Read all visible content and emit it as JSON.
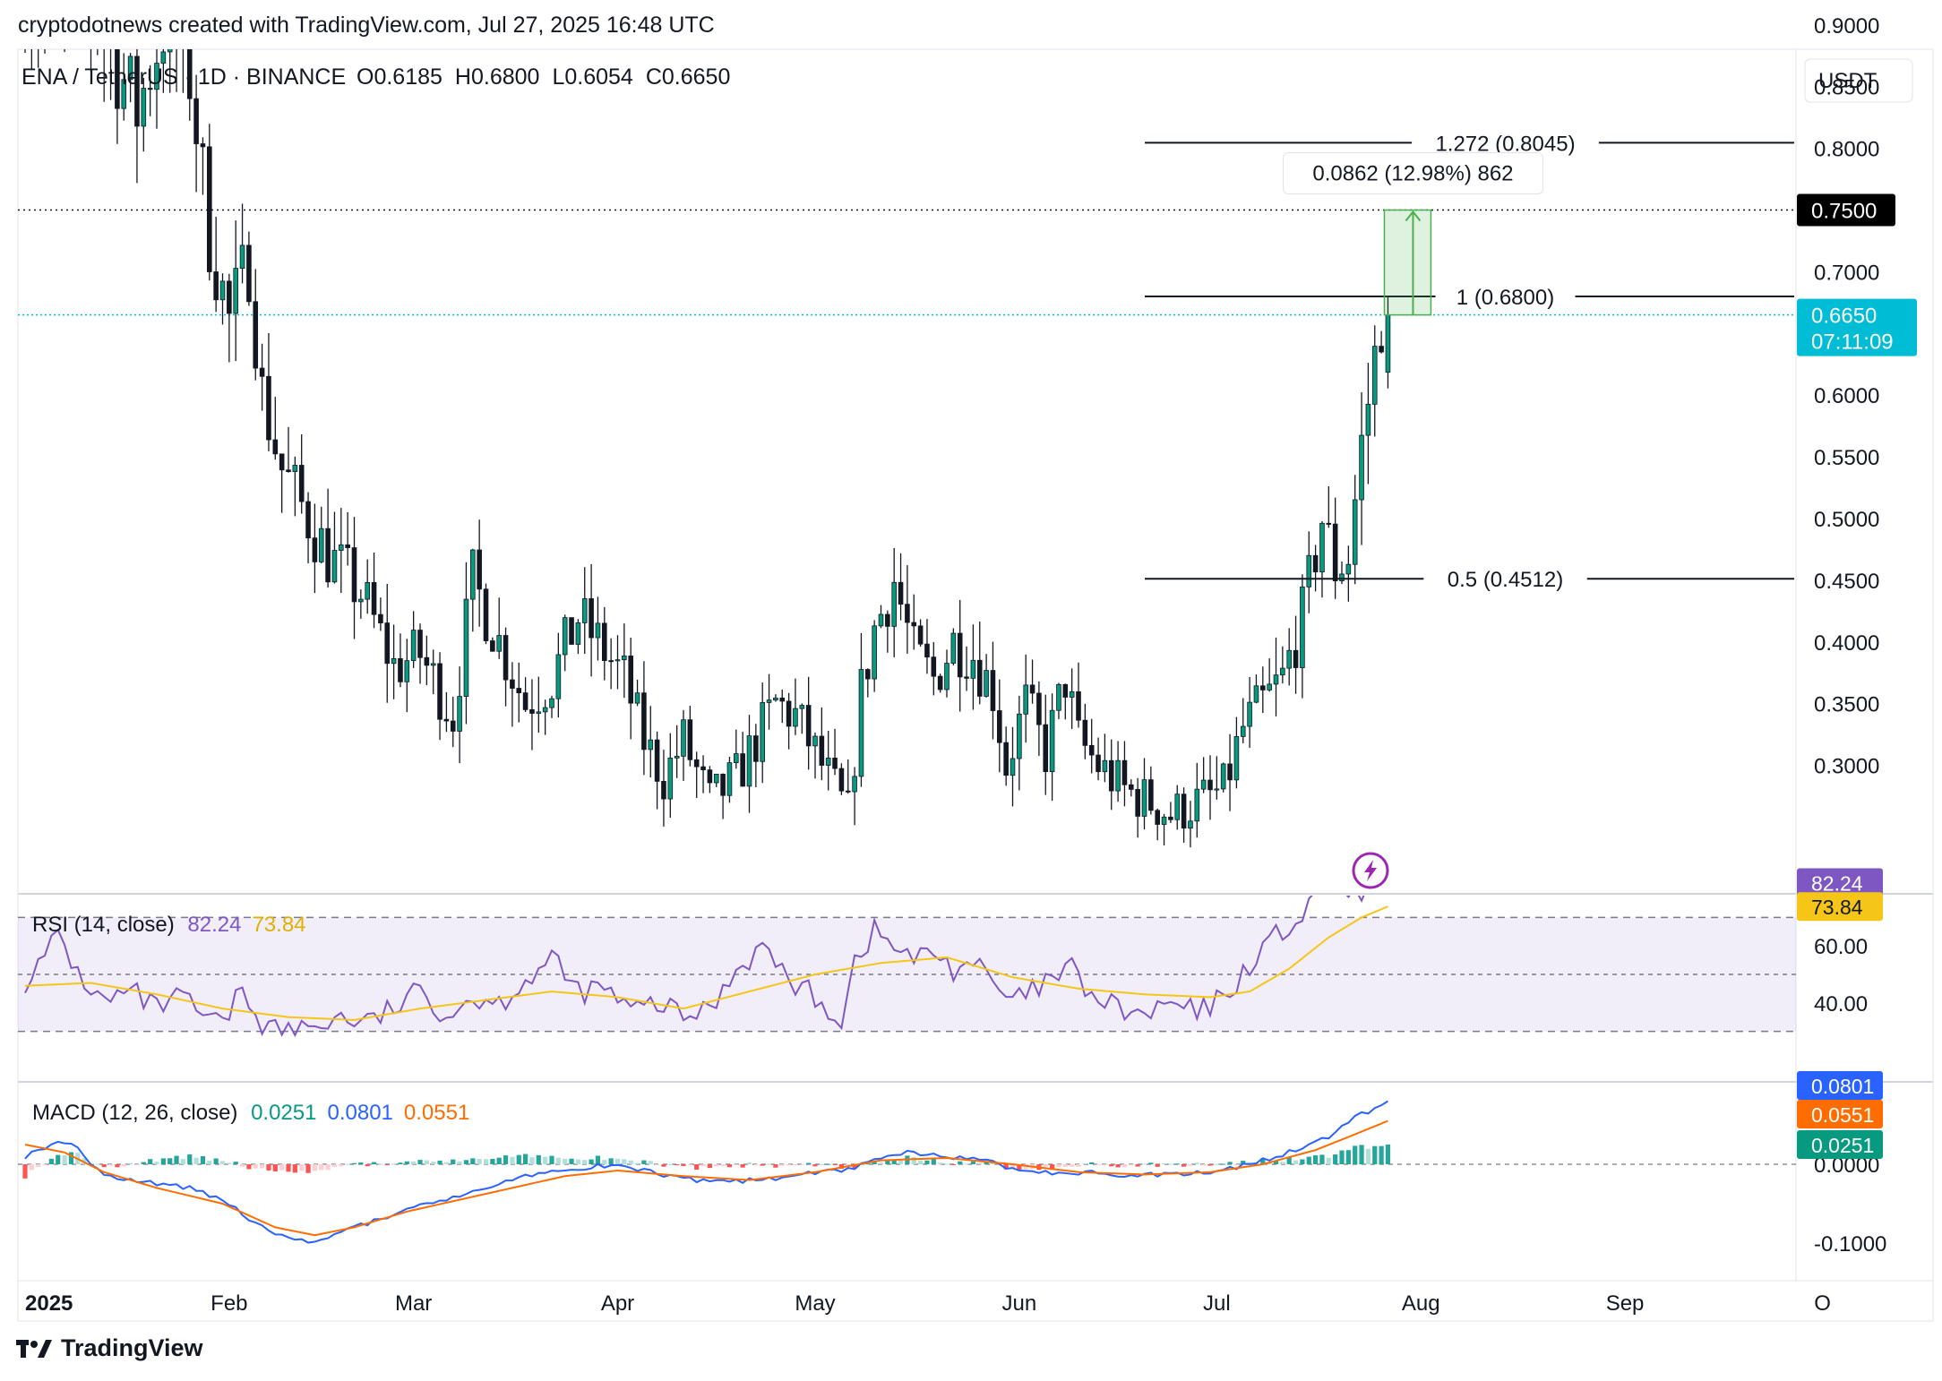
{
  "attribution": "cryptodotnews created with TradingView.com, Jul 27, 2025 16:48 UTC",
  "brand": "TradingView",
  "colors": {
    "up": "#089981",
    "down": "#f23645",
    "rsi": "#7e57c2",
    "rsi_ma": "#f5c518",
    "macd": "#2962ff",
    "signal": "#ff6d00",
    "price_tag": "#00bcd4",
    "level_tag": "#000000"
  },
  "chart_data": [
    {
      "type": "candlestick",
      "symbol_title": "ENA / TetherUS · 1D · BINANCE",
      "ohlc": {
        "o": "0.6185",
        "h": "0.6800",
        "l": "0.6054",
        "c": "0.6650"
      },
      "ohlc_labels": {
        "o": "O",
        "h": "H",
        "l": "L",
        "c": "C"
      },
      "currency": "USDT",
      "ylim": [
        0.27,
        0.96
      ],
      "yticks": [
        "0.9000",
        "0.8500",
        "0.8000",
        "0.7000",
        "0.6000",
        "0.5500",
        "0.5000",
        "0.4500",
        "0.4000",
        "0.3500",
        "0.3000"
      ],
      "x_labels": [
        "2025",
        "Feb",
        "Mar",
        "Apr",
        "May",
        "Jun",
        "Jul",
        "Aug",
        "Sep",
        "O"
      ],
      "x_label_days": [
        0,
        31,
        59,
        90,
        120,
        151,
        181,
        212,
        243,
        273
      ],
      "current_price": "0.6650",
      "countdown": "07:11:09",
      "target_level": "0.7500",
      "fib_levels": [
        {
          "label": "1.272 (0.8045)",
          "value": 0.8045
        },
        {
          "label": "1 (0.6800)",
          "value": 0.68
        },
        {
          "label": "0.5 (0.4512)",
          "value": 0.4512
        }
      ],
      "measure": {
        "label": "0.0862 (12.98%) 862",
        "from": 0.665,
        "to": 0.75
      },
      "anchors": [
        [
          0,
          0.94
        ],
        [
          6,
          0.91
        ],
        [
          10,
          0.93
        ],
        [
          14,
          0.88
        ],
        [
          18,
          0.83
        ],
        [
          22,
          0.9
        ],
        [
          26,
          0.86
        ],
        [
          29,
          0.73
        ],
        [
          32,
          0.66
        ],
        [
          35,
          0.71
        ],
        [
          37,
          0.6
        ],
        [
          40,
          0.54
        ],
        [
          43,
          0.51
        ],
        [
          47,
          0.47
        ],
        [
          52,
          0.44
        ],
        [
          57,
          0.38
        ],
        [
          61,
          0.39
        ],
        [
          66,
          0.34
        ],
        [
          69,
          0.45
        ],
        [
          73,
          0.4
        ],
        [
          77,
          0.35
        ],
        [
          81,
          0.37
        ],
        [
          85,
          0.42
        ],
        [
          88,
          0.4
        ],
        [
          92,
          0.37
        ],
        [
          95,
          0.32
        ],
        [
          98,
          0.29
        ],
        [
          101,
          0.32
        ],
        [
          105,
          0.27
        ],
        [
          109,
          0.29
        ],
        [
          112,
          0.32
        ],
        [
          115,
          0.35
        ],
        [
          118,
          0.34
        ],
        [
          121,
          0.31
        ],
        [
          124,
          0.28
        ],
        [
          126,
          0.26
        ],
        [
          128,
          0.36
        ],
        [
          130,
          0.41
        ],
        [
          133,
          0.45
        ],
        [
          136,
          0.39
        ],
        [
          139,
          0.37
        ],
        [
          142,
          0.4
        ],
        [
          145,
          0.39
        ],
        [
          148,
          0.36
        ],
        [
          150,
          0.3
        ],
        [
          153,
          0.35
        ],
        [
          156,
          0.31
        ],
        [
          159,
          0.37
        ],
        [
          161,
          0.32
        ],
        [
          164,
          0.3
        ],
        [
          168,
          0.28
        ],
        [
          172,
          0.27
        ],
        [
          175,
          0.26
        ],
        [
          179,
          0.27
        ],
        [
          183,
          0.28
        ],
        [
          186,
          0.33
        ],
        [
          189,
          0.35
        ],
        [
          192,
          0.37
        ],
        [
          195,
          0.42
        ],
        [
          198,
          0.5
        ],
        [
          200,
          0.46
        ],
        [
          202,
          0.47
        ],
        [
          204,
          0.56
        ],
        [
          206,
          0.63
        ],
        [
          207,
          0.665
        ]
      ],
      "last_candle": {
        "o": 0.6185,
        "h": 0.68,
        "l": 0.6054,
        "c": 0.665
      }
    },
    {
      "type": "line",
      "title": "RSI (14, close)",
      "values_display": [
        "82.24",
        "73.84"
      ],
      "series_names": [
        "RSI",
        "RSI-based MA"
      ],
      "ylim": [
        22,
        89
      ],
      "yticks": [
        "60.00",
        "40.00"
      ],
      "bands": [
        70,
        50,
        30
      ],
      "anchors": [
        [
          0,
          48
        ],
        [
          3,
          55
        ],
        [
          5,
          65
        ],
        [
          8,
          50
        ],
        [
          12,
          40
        ],
        [
          16,
          44
        ],
        [
          20,
          38
        ],
        [
          24,
          42
        ],
        [
          27,
          35
        ],
        [
          30,
          32
        ],
        [
          33,
          45
        ],
        [
          36,
          33
        ],
        [
          40,
          30
        ],
        [
          44,
          32
        ],
        [
          48,
          35
        ],
        [
          52,
          33
        ],
        [
          56,
          38
        ],
        [
          60,
          44
        ],
        [
          64,
          36
        ],
        [
          68,
          42
        ],
        [
          72,
          40
        ],
        [
          76,
          48
        ],
        [
          80,
          55
        ],
        [
          84,
          44
        ],
        [
          88,
          45
        ],
        [
          92,
          37
        ],
        [
          96,
          40
        ],
        [
          100,
          35
        ],
        [
          104,
          38
        ],
        [
          108,
          52
        ],
        [
          112,
          60
        ],
        [
          116,
          48
        ],
        [
          120,
          42
        ],
        [
          124,
          34
        ],
        [
          126,
          55
        ],
        [
          129,
          65
        ],
        [
          132,
          60
        ],
        [
          135,
          55
        ],
        [
          138,
          58
        ],
        [
          141,
          52
        ],
        [
          144,
          55
        ],
        [
          147,
          46
        ],
        [
          150,
          40
        ],
        [
          153,
          44
        ],
        [
          156,
          48
        ],
        [
          159,
          52
        ],
        [
          162,
          42
        ],
        [
          166,
          38
        ],
        [
          170,
          35
        ],
        [
          174,
          40
        ],
        [
          178,
          36
        ],
        [
          182,
          42
        ],
        [
          185,
          50
        ],
        [
          188,
          60
        ],
        [
          191,
          65
        ],
        [
          194,
          70
        ],
        [
          197,
          78
        ],
        [
          199,
          84
        ],
        [
          201,
          74
        ],
        [
          203,
          78
        ],
        [
          205,
          84
        ],
        [
          207,
          82.24
        ]
      ],
      "ma_anchors": [
        [
          0,
          46
        ],
        [
          10,
          47
        ],
        [
          20,
          43
        ],
        [
          30,
          38
        ],
        [
          40,
          35
        ],
        [
          50,
          34
        ],
        [
          60,
          38
        ],
        [
          70,
          41
        ],
        [
          80,
          44
        ],
        [
          90,
          42
        ],
        [
          100,
          38
        ],
        [
          110,
          44
        ],
        [
          120,
          50
        ],
        [
          130,
          54
        ],
        [
          140,
          56
        ],
        [
          150,
          49
        ],
        [
          160,
          45
        ],
        [
          170,
          43
        ],
        [
          180,
          42
        ],
        [
          186,
          44
        ],
        [
          192,
          52
        ],
        [
          198,
          63
        ],
        [
          203,
          70
        ],
        [
          207,
          73.84
        ]
      ]
    },
    {
      "type": "line",
      "title": "MACD (12, 26, close)",
      "values_display": [
        "0.0251",
        "0.0801",
        "0.0551"
      ],
      "series_names": [
        "Histogram",
        "MACD",
        "Signal"
      ],
      "ylim": [
        -0.13,
        0.11
      ],
      "yticks": [
        "0.0000",
        "-0.1000"
      ],
      "macd_anchors": [
        [
          0,
          0.01
        ],
        [
          5,
          0.03
        ],
        [
          8,
          0.02
        ],
        [
          12,
          -0.015
        ],
        [
          16,
          -0.02
        ],
        [
          20,
          -0.025
        ],
        [
          25,
          -0.03
        ],
        [
          30,
          -0.045
        ],
        [
          36,
          -0.08
        ],
        [
          40,
          -0.095
        ],
        [
          44,
          -0.1
        ],
        [
          48,
          -0.085
        ],
        [
          54,
          -0.07
        ],
        [
          60,
          -0.05
        ],
        [
          66,
          -0.04
        ],
        [
          72,
          -0.025
        ],
        [
          78,
          -0.01
        ],
        [
          84,
          -0.005
        ],
        [
          90,
          0.0
        ],
        [
          96,
          -0.012
        ],
        [
          102,
          -0.02
        ],
        [
          108,
          -0.022
        ],
        [
          114,
          -0.018
        ],
        [
          120,
          -0.01
        ],
        [
          126,
          -0.005
        ],
        [
          130,
          0.008
        ],
        [
          134,
          0.015
        ],
        [
          138,
          0.012
        ],
        [
          142,
          0.008
        ],
        [
          146,
          0.004
        ],
        [
          150,
          -0.006
        ],
        [
          156,
          -0.012
        ],
        [
          162,
          -0.01
        ],
        [
          168,
          -0.015
        ],
        [
          174,
          -0.012
        ],
        [
          180,
          -0.01
        ],
        [
          186,
          0.0
        ],
        [
          192,
          0.015
        ],
        [
          198,
          0.035
        ],
        [
          202,
          0.06
        ],
        [
          205,
          0.07
        ],
        [
          207,
          0.0801
        ]
      ],
      "signal_anchors": [
        [
          0,
          0.025
        ],
        [
          6,
          0.015
        ],
        [
          12,
          -0.01
        ],
        [
          20,
          -0.03
        ],
        [
          30,
          -0.05
        ],
        [
          38,
          -0.08
        ],
        [
          44,
          -0.09
        ],
        [
          50,
          -0.08
        ],
        [
          58,
          -0.06
        ],
        [
          66,
          -0.045
        ],
        [
          74,
          -0.03
        ],
        [
          82,
          -0.015
        ],
        [
          90,
          -0.008
        ],
        [
          100,
          -0.015
        ],
        [
          110,
          -0.02
        ],
        [
          120,
          -0.01
        ],
        [
          130,
          0.005
        ],
        [
          140,
          0.008
        ],
        [
          150,
          0.0
        ],
        [
          160,
          -0.01
        ],
        [
          170,
          -0.013
        ],
        [
          180,
          -0.01
        ],
        [
          188,
          0.0
        ],
        [
          196,
          0.018
        ],
        [
          202,
          0.038
        ],
        [
          207,
          0.0551
        ]
      ]
    }
  ]
}
